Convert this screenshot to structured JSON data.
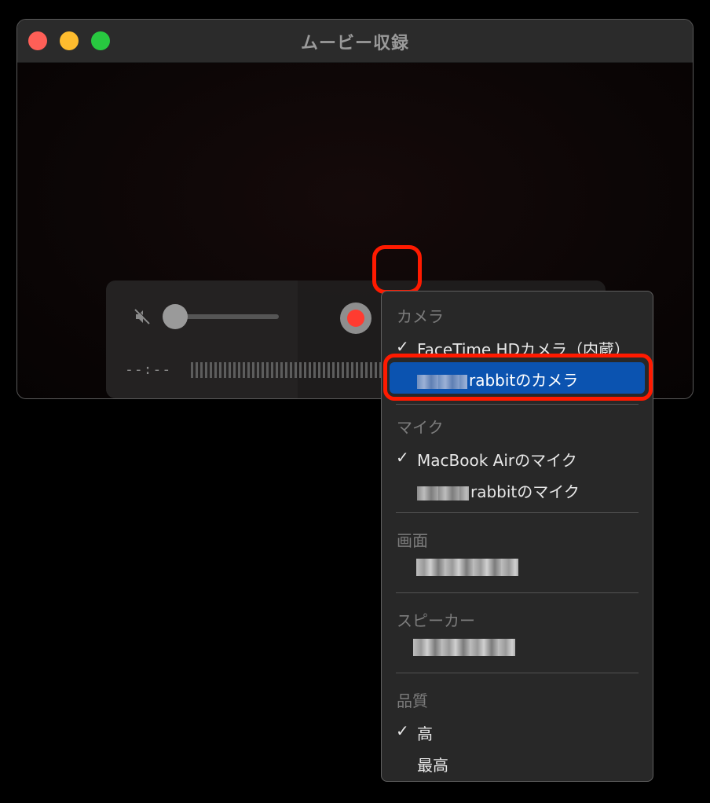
{
  "window": {
    "title": "ムービー収録"
  },
  "controls": {
    "timecode": "--:--",
    "volume_level": 0.0,
    "mute_icon": "speaker-muted-icon",
    "record_icon": "record-icon",
    "options_icon": "chevron-down-icon"
  },
  "menu": {
    "camera_header": "カメラ",
    "camera_items": [
      {
        "label": "FaceTime HDカメラ（内蔵）",
        "checked": true
      },
      {
        "label": "rabbitのカメラ",
        "checked": false,
        "selected": true
      }
    ],
    "mic_header": "マイク",
    "mic_items": [
      {
        "label": "MacBook Airのマイク",
        "checked": true
      },
      {
        "label": "rabbitのマイク",
        "checked": false
      }
    ],
    "screen_header": "画面",
    "speaker_header": "スピーカー",
    "quality_header": "品質",
    "quality_items": [
      {
        "label": "高",
        "checked": true
      },
      {
        "label": "最高",
        "checked": false
      }
    ],
    "check_glyph": "✓"
  },
  "colors": {
    "highlight": "#ff1a00",
    "selection": "#0b53b0",
    "record": "#ff3b30"
  }
}
